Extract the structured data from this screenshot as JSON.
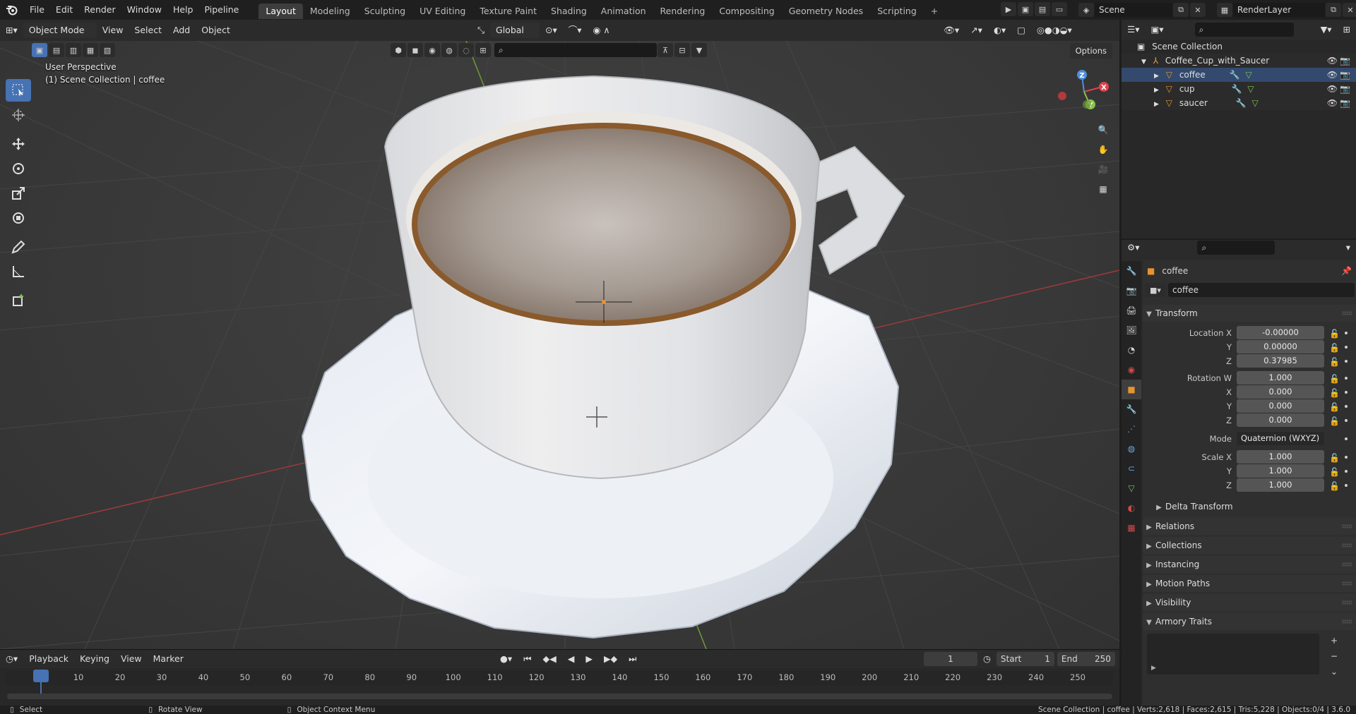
{
  "menu": {
    "items": [
      "File",
      "Edit",
      "Render",
      "Window",
      "Help",
      "Pipeline"
    ],
    "workspaces": [
      "Layout",
      "Modeling",
      "Sculpting",
      "UV Editing",
      "Texture Paint",
      "Shading",
      "Animation",
      "Rendering",
      "Compositing",
      "Geometry Nodes",
      "Scripting"
    ],
    "active_workspace": "Layout",
    "add_tab": "+",
    "scene_name": "Scene",
    "view_layer": "RenderLayer"
  },
  "viewport": {
    "mode": "Object Mode",
    "menus": [
      "View",
      "Select",
      "Add",
      "Object"
    ],
    "orientation": "Global",
    "options_label": "Options",
    "info_line1": "User Perspective",
    "info_line2": "(1) Scene Collection | coffee",
    "axis_labels": {
      "x": "X",
      "y": "Y",
      "z": "Z"
    },
    "tools": [
      "select-box",
      "cursor",
      "move",
      "rotate",
      "scale",
      "transform",
      "annotate",
      "measure",
      "add-cube"
    ]
  },
  "outliner": {
    "root": "Scene Collection",
    "collection": "Coffee_Cup_with_Saucer",
    "objects": [
      "coffee",
      "cup",
      "saucer"
    ]
  },
  "properties": {
    "object_name": "coffee",
    "datablock_name": "coffee",
    "transform": {
      "title": "Transform",
      "location_label": "Location X",
      "location": [
        "-0.00000",
        "0.00000",
        "0.37985"
      ],
      "rotation_label": "Rotation W",
      "rotation": [
        "1.000",
        "0.000",
        "0.000",
        "0.000"
      ],
      "mode_label": "Mode",
      "mode_value": "Quaternion (WXYZ)",
      "scale_label": "Scale X",
      "scale": [
        "1.000",
        "1.000",
        "1.000"
      ],
      "y": "Y",
      "z": "Z",
      "x": "X"
    },
    "delta_transform": "Delta Transform",
    "panels": [
      "Relations",
      "Collections",
      "Instancing",
      "Motion Paths",
      "Visibility",
      "Armory Traits"
    ]
  },
  "timeline": {
    "menus": [
      "Playback",
      "Keying",
      "View",
      "Marker"
    ],
    "current_frame": "1",
    "start_label": "Start",
    "start": "1",
    "end_label": "End",
    "end": "250",
    "ticks": [
      "1",
      "10",
      "20",
      "30",
      "40",
      "50",
      "60",
      "70",
      "80",
      "90",
      "100",
      "110",
      "120",
      "130",
      "140",
      "150",
      "160",
      "170",
      "180",
      "190",
      "200",
      "210",
      "220",
      "230",
      "240",
      "250"
    ]
  },
  "statusbar": {
    "select": "Select",
    "rotate": "Rotate View",
    "context": "Object Context Menu",
    "stats": "Scene Collection | coffee | Verts:2,618 | Faces:2,615 | Tris:5,228 | Objects:0/4 | 3.6.0"
  },
  "colors": {
    "accent": "#4772b3",
    "x_axis": "#e0434a",
    "y_axis": "#8ac24a",
    "z_axis": "#4f8ed9",
    "object_orange": "#e8942e"
  }
}
